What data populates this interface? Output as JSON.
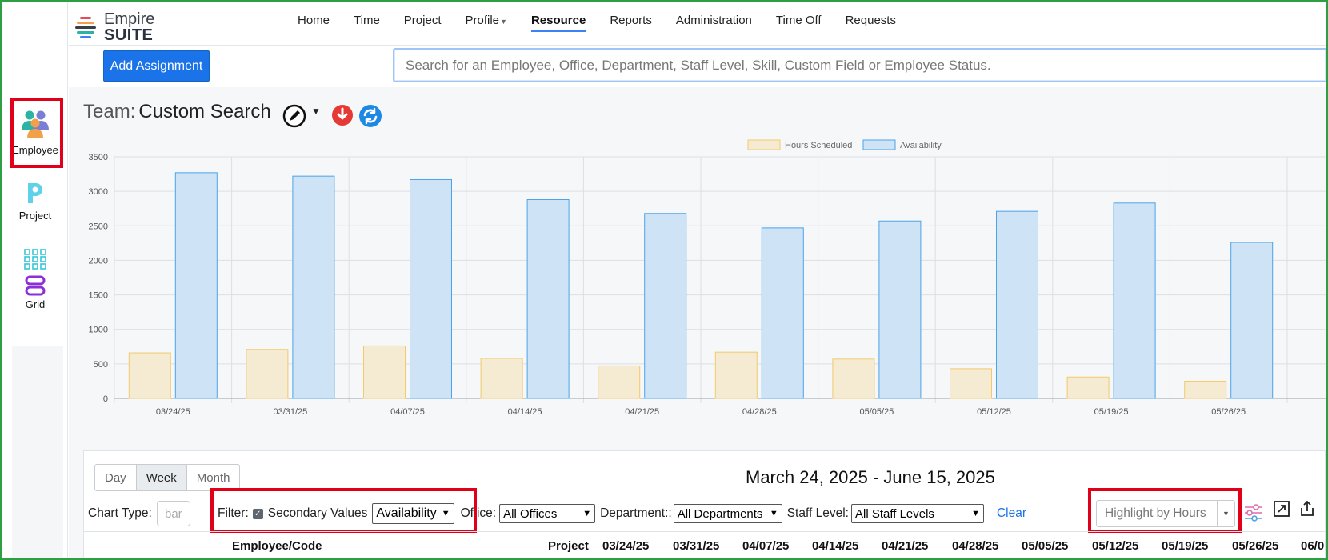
{
  "rail": {
    "items": [
      {
        "label": "Employee",
        "icon": "people-icon"
      },
      {
        "label": "Project",
        "icon": "project-p-icon"
      },
      {
        "label": "Grid",
        "icon": "grid-icon"
      }
    ]
  },
  "logo": {
    "line1": "Empire",
    "line2": "SUITE"
  },
  "nav": {
    "items": [
      "Home",
      "Time",
      "Project",
      "Profile",
      "Resource",
      "Reports",
      "Administration",
      "Time Off",
      "Requests"
    ],
    "active": "Resource"
  },
  "toolbar": {
    "add_label": "Add Assignment",
    "search_placeholder": "Search for an Employee, Office, Department, Staff Level, Skill, Custom Field or Employee Status."
  },
  "team": {
    "prefix": "Team:",
    "value": "Custom Search"
  },
  "chart_data": {
    "type": "bar",
    "categories": [
      "03/24/25",
      "03/31/25",
      "04/07/25",
      "04/14/25",
      "04/21/25",
      "04/28/25",
      "05/05/25",
      "05/12/25",
      "05/19/25",
      "05/26/25"
    ],
    "series": [
      {
        "name": "Hours Scheduled",
        "values": [
          660,
          710,
          760,
          580,
          470,
          670,
          570,
          430,
          310,
          250
        ],
        "fill": "#f5ebd3",
        "stroke": "#f3c96b"
      },
      {
        "name": "Availability",
        "values": [
          3270,
          3220,
          3170,
          2880,
          2680,
          2470,
          2570,
          2710,
          2830,
          2260
        ],
        "fill": "#cfe3f7",
        "stroke": "#4ba3e6"
      }
    ],
    "ylim": [
      0,
      3500
    ],
    "yticks": [
      0,
      500,
      1000,
      1500,
      2000,
      2500,
      3000,
      3500
    ],
    "grid": true,
    "legend": "top"
  },
  "views": [
    "Day",
    "Week",
    "Month"
  ],
  "active_view": "Week",
  "date_range": "March 24, 2025 - June 15, 2025",
  "controls": {
    "chart_type_label": "Chart Type:",
    "chart_type_value": "bar",
    "filter_label": "Filter:",
    "secondary_label": "Secondary Values",
    "secondary_value": "Availability",
    "office_label": "Office:",
    "office_value": "All Offices",
    "department_label": "Department::",
    "department_value": "All Departments",
    "staff_label": "Staff Level:",
    "staff_value": "All Staff Levels",
    "clear_label": "Clear",
    "highlight_value": "Highlight by Hours"
  },
  "table": {
    "headers": [
      "Employee/Code",
      "Project",
      "03/24/25",
      "03/31/25",
      "04/07/25",
      "04/14/25",
      "04/21/25",
      "04/28/25",
      "05/05/25",
      "05/12/25",
      "05/19/25",
      "05/26/25",
      "06/0"
    ]
  }
}
